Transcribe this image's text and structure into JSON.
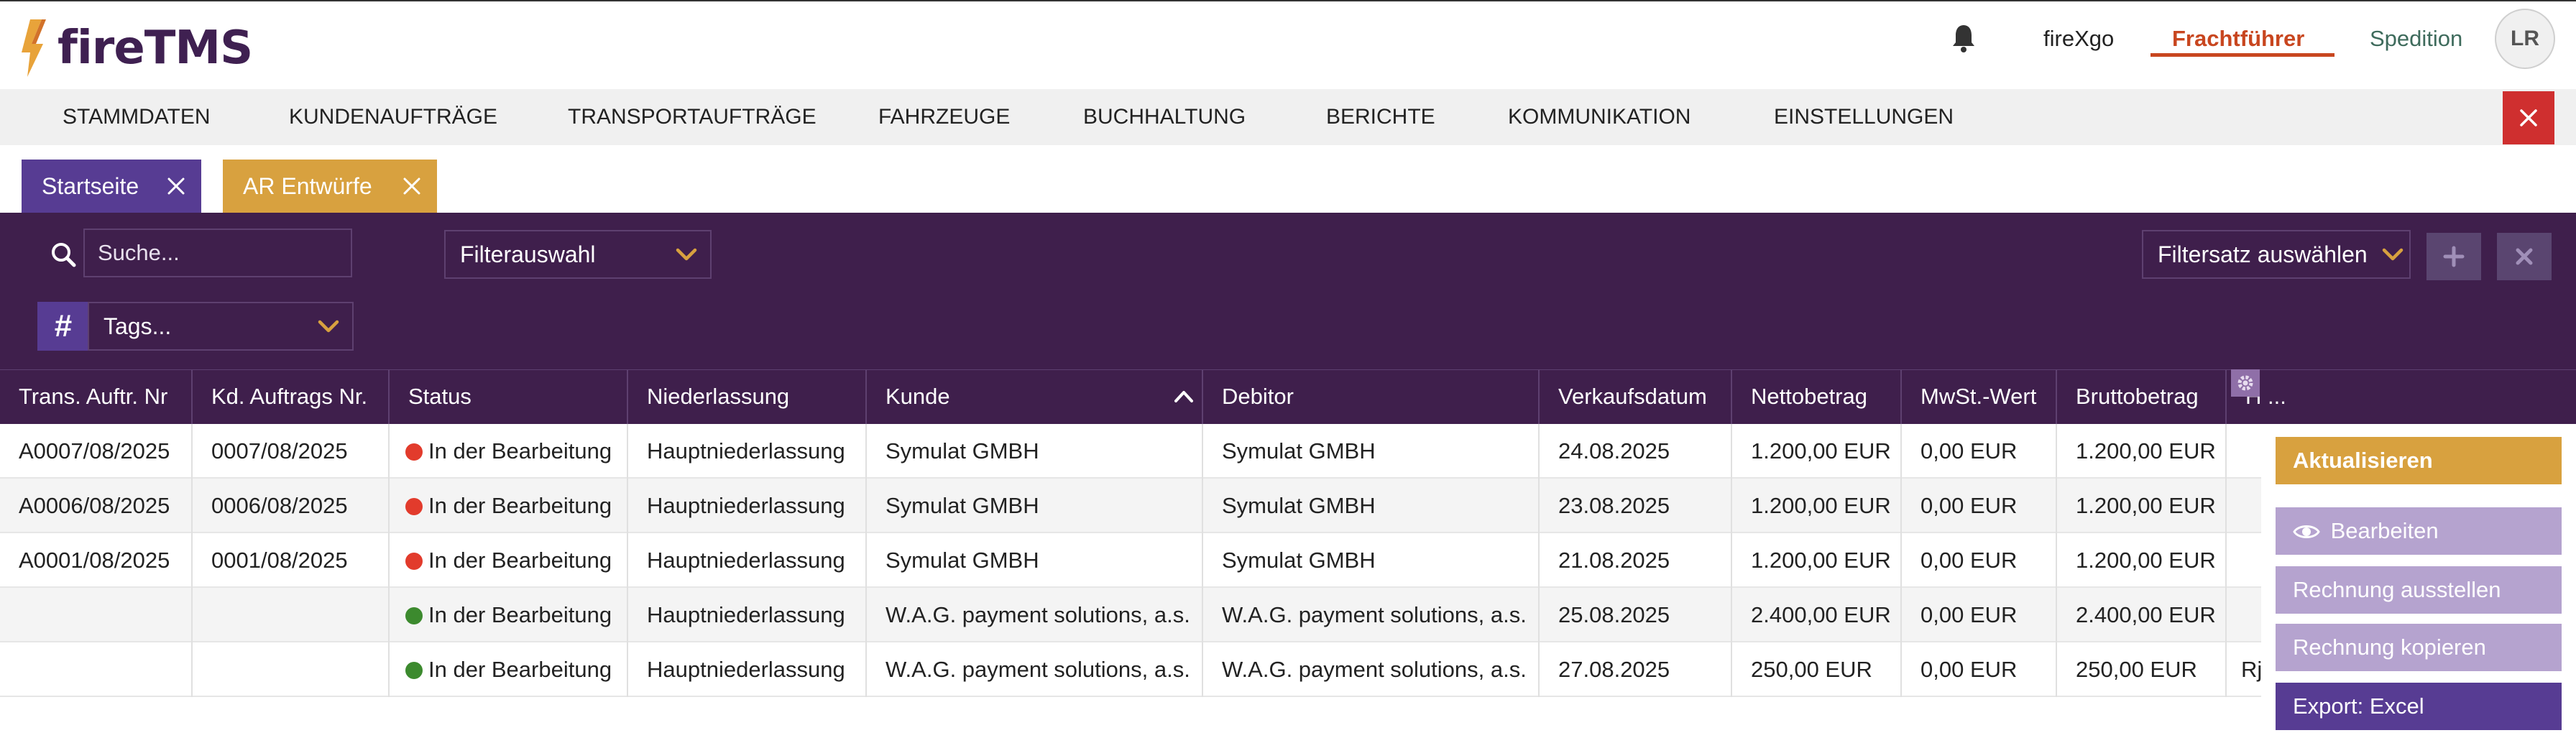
{
  "header": {
    "logo_text": "fireTMS",
    "links": {
      "firexgo": "fireXgo",
      "frachtfuehrer": "Frachtführer",
      "spedition": "Spedition"
    },
    "avatar_initials": "LR",
    "accent_color": "#c8461f",
    "brand_color": "#3f2051"
  },
  "menu": {
    "items": [
      "STAMMDATEN",
      "KUNDENAUFTRÄGE",
      "TRANSPORTAUFTRÄGE",
      "FAHRZEUGE",
      "BUCHHALTUNG",
      "BERICHTE",
      "KOMMUNIKATION",
      "EINSTELLUNGEN"
    ]
  },
  "tabs": [
    {
      "label": "Startseite",
      "color": "#573c93"
    },
    {
      "label": "AR Entwürfe",
      "color": "#d8a13f"
    }
  ],
  "filters": {
    "search_placeholder": "Suche...",
    "filter_select": "Filterauswahl",
    "filterset_select": "Filtersatz auswählen",
    "tags_placeholder": "Tags...",
    "tags_symbol": "#"
  },
  "table": {
    "columns": [
      "Trans. Auftr. Nr",
      "Kd. Auftrags Nr.",
      "Status",
      "Niederlassung",
      "Kunde",
      "Debitor",
      "Verkaufsdatum",
      "Nettobetrag",
      "MwSt.-Wert",
      "Bruttobetrag",
      "H ..."
    ],
    "sorted_column": "Kunde",
    "rows": [
      {
        "trans": "A0007/08/2025",
        "kd": "0007/08/2025",
        "status": "In der Bearbeitung",
        "status_color": "red",
        "niederlassung": "Hauptniederlassung",
        "kunde": "Symulat GMBH",
        "debitor": "Symulat GMBH",
        "datum": "24.08.2025",
        "netto": "1.200,00 EUR",
        "mwst": "0,00 EUR",
        "brutto": "1.200,00 EUR",
        "h": ""
      },
      {
        "trans": "A0006/08/2025",
        "kd": "0006/08/2025",
        "status": "In der Bearbeitung",
        "status_color": "red",
        "niederlassung": "Hauptniederlassung",
        "kunde": "Symulat GMBH",
        "debitor": "Symulat GMBH",
        "datum": "23.08.2025",
        "netto": "1.200,00 EUR",
        "mwst": "0,00 EUR",
        "brutto": "1.200,00 EUR",
        "h": ""
      },
      {
        "trans": "A0001/08/2025",
        "kd": "0001/08/2025",
        "status": "In der Bearbeitung",
        "status_color": "red",
        "niederlassung": "Hauptniederlassung",
        "kunde": "Symulat GMBH",
        "debitor": "Symulat GMBH",
        "datum": "21.08.2025",
        "netto": "1.200,00 EUR",
        "mwst": "0,00 EUR",
        "brutto": "1.200,00 EUR",
        "h": ""
      },
      {
        "trans": "",
        "kd": "",
        "status": "In der Bearbeitung",
        "status_color": "green",
        "niederlassung": "Hauptniederlassung",
        "kunde": "W.A.G. payment solutions, a.s.",
        "debitor": "W.A.G. payment solutions, a.s.",
        "datum": "25.08.2025",
        "netto": "2.400,00 EUR",
        "mwst": "0,00 EUR",
        "brutto": "2.400,00 EUR",
        "h": ""
      },
      {
        "trans": "",
        "kd": "",
        "status": "In der Bearbeitung",
        "status_color": "green",
        "niederlassung": "Hauptniederlassung",
        "kunde": "W.A.G. payment solutions, a.s.",
        "debitor": "W.A.G. payment solutions, a.s.",
        "datum": "27.08.2025",
        "netto": "250,00 EUR",
        "mwst": "0,00 EUR",
        "brutto": "250,00 EUR",
        "h": "Rj"
      }
    ]
  },
  "actions": {
    "refresh": "Aktualisieren",
    "edit": "Bearbeiten",
    "issue_invoice": "Rechnung ausstellen",
    "copy_invoice": "Rechnung kopieren",
    "export": "Export: Excel"
  }
}
